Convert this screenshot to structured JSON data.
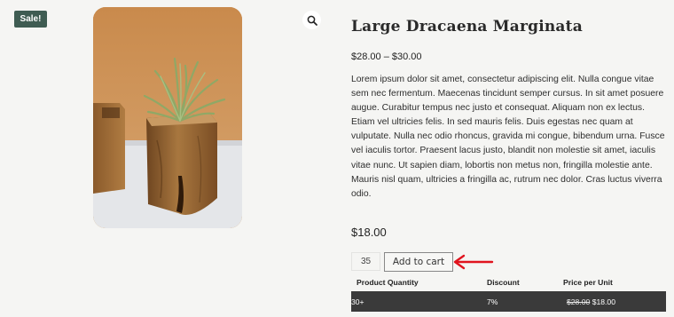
{
  "badge": {
    "label": "Sale!"
  },
  "product": {
    "title": "Large Dracaena Marginata",
    "price_range": "$28.00 – $30.00",
    "description": "Lorem ipsum dolor sit amet, consectetur adipiscing elit. Nulla congue vitae sem nec fermentum. Maecenas tincidunt semper cursus. In sit amet posuere augue. Curabitur tempus nec justo et consequat. Aliquam non ex lectus. Etiam vel ultricies felis. In sed mauris felis. Duis egestas nec quam at vulputate. Nulla nec odio rhoncus, gravida mi congue, bibendum urna. Fusce vel iaculis tortor. Praesent lacus justo, blandit non molestie sit amet, iaculis vitae nunc. Ut sapien diam, lobortis non metus non, fringilla molestie ante. Mauris nisl quam, ultricies a fringilla ac, rutrum nec dolor. Cras luctus viverra odio.",
    "current_price": "$18.00"
  },
  "cart": {
    "quantity": "35",
    "add_label": "Add to cart"
  },
  "pricing_table": {
    "headers": [
      "Product Quantity",
      "Discount",
      "Price per Unit"
    ],
    "rows": [
      {
        "quantity": "30+",
        "discount": "7%",
        "old_price": "$28.00",
        "new_price": "$18.00"
      }
    ]
  },
  "icons": {
    "zoom": "magnifier-icon",
    "annotation": "red-arrow-icon"
  },
  "colors": {
    "badge": "#3f5c52",
    "table_row": "#3a3a3a",
    "arrow": "#e0141e",
    "background": "#f5f5f3"
  }
}
